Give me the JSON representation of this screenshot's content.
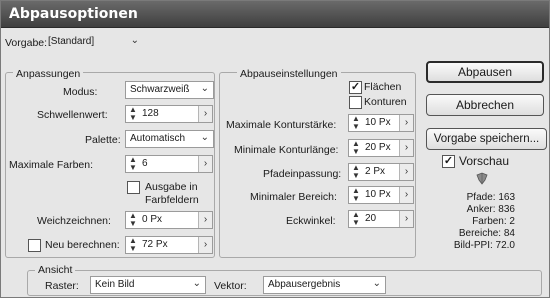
{
  "window": {
    "title": "Abpausoptionen"
  },
  "preset": {
    "label": "Vorgabe:",
    "value": "[Standard]"
  },
  "adjustments": {
    "title": "Anpassungen",
    "mode": {
      "label": "Modus:",
      "value": "Schwarzweiß"
    },
    "threshold": {
      "label": "Schwellenwert:",
      "value": "128"
    },
    "palette": {
      "label": "Palette:",
      "value": "Automatisch"
    },
    "max_colors": {
      "label": "Maximale Farben:",
      "value": "6"
    },
    "output_swatches": {
      "label": "Ausgabe in Farbfeldern",
      "label_line1": "Ausgabe in",
      "label_line2": "Farbfeldern",
      "checked": false
    },
    "blur": {
      "label": "Weichzeichnen:",
      "value": "0 Px"
    },
    "resample": {
      "label": "Neu berechnen:",
      "value": "72 Px",
      "checked": false
    }
  },
  "trace_settings": {
    "title": "Abpauseinstellungen",
    "fills": {
      "label": "Flächen",
      "checked": true
    },
    "strokes": {
      "label": "Konturen",
      "checked": false
    },
    "max_stroke_weight": {
      "label": "Maximale Konturstärke:",
      "value": "10 Px"
    },
    "min_stroke_length": {
      "label": "Minimale Konturlänge:",
      "value": "20 Px"
    },
    "path_fitting": {
      "label": "Pfadeinpassung:",
      "value": "2 Px"
    },
    "min_area": {
      "label": "Minimaler Bereich:",
      "value": "10 Px"
    },
    "corner_angle": {
      "label": "Eckwinkel:",
      "value": "20"
    }
  },
  "buttons": {
    "trace": "Abpausen",
    "cancel": "Abbrechen",
    "save_preset": "Vorgabe speichern..."
  },
  "preview": {
    "label": "Vorschau",
    "checked": true
  },
  "stats": {
    "paths": "Pfade: 163",
    "anchors": "Anker: 836",
    "colors": "Farben: 2",
    "areas": "Bereiche: 84",
    "image_ppi": "Bild-PPI: 72.0"
  },
  "view": {
    "title": "Ansicht",
    "raster": {
      "label": "Raster:",
      "value": "Kein Bild"
    },
    "vector": {
      "label": "Vektor:",
      "value": "Abpausergebnis"
    }
  }
}
